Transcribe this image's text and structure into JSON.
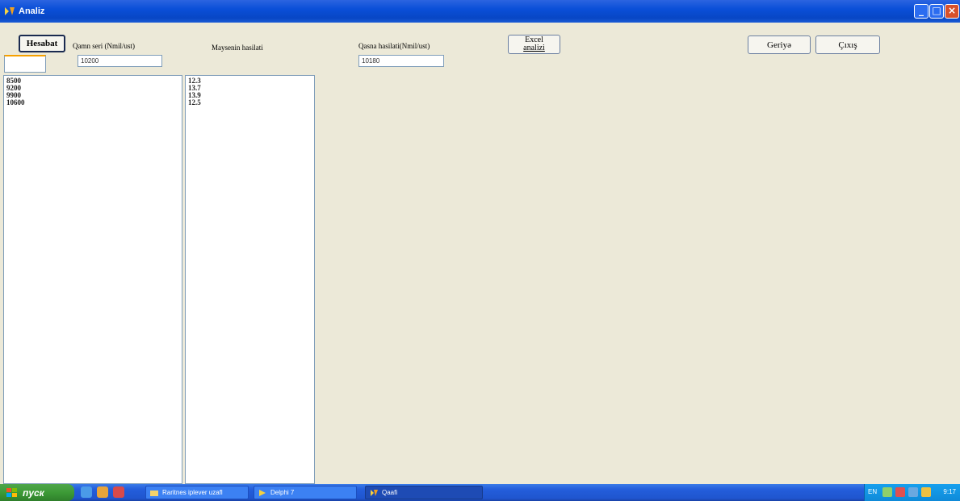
{
  "window": {
    "title": "Analiz",
    "app_icon": "app-icon"
  },
  "toolbar": {
    "calc_button": "Hesabat",
    "label_series": "Qamn seri (Nmil/ust)",
    "label_yield": "Maysenin hasilati",
    "label_limit": "Qasna hasilati(Nmil/ust)",
    "input_small_value": "",
    "input_series_value": "10200",
    "input_limit_value": "10180",
    "excel_button_line1": "Excel",
    "excel_button_line2": "analizi",
    "back_button": "Geriyə",
    "exit_button": "Çıxış"
  },
  "list_left": [
    "8500",
    "9200",
    "9900",
    "10600"
  ],
  "list_right": [
    "12.3",
    "13.7",
    "13.9",
    "12.5"
  ],
  "taskbar": {
    "start_label": "пуск",
    "tasks": [
      {
        "label": "Raritnes iplever uzafl",
        "icon": "folder-icon"
      },
      {
        "label": "Delphi 7",
        "icon": "delphi-icon"
      },
      {
        "label": "Qaafi",
        "icon": "app-icon"
      }
    ],
    "lang": "EN",
    "clock": "9:17"
  }
}
